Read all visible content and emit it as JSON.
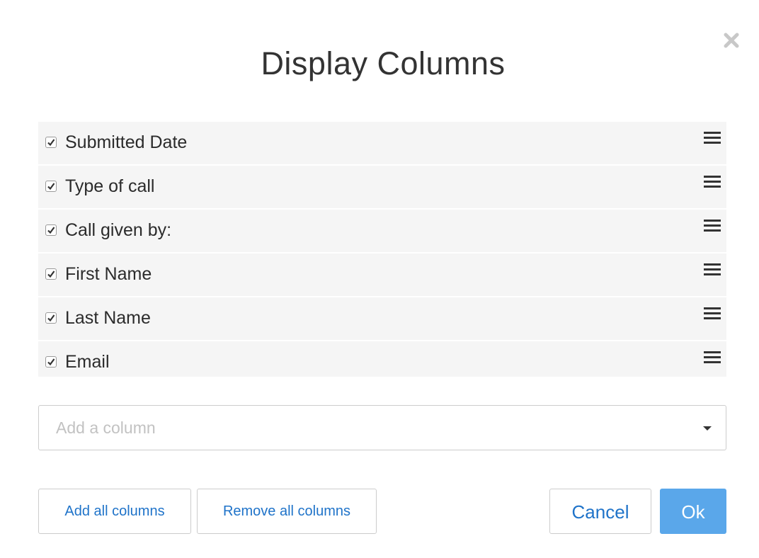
{
  "dialog": {
    "title": "Display Columns",
    "close_icon": "close-icon"
  },
  "columns": [
    {
      "label": "Submitted Date",
      "checked": true
    },
    {
      "label": "Type of call",
      "checked": true
    },
    {
      "label": "Call given by:",
      "checked": true
    },
    {
      "label": "First Name",
      "checked": true
    },
    {
      "label": "Last Name",
      "checked": true
    },
    {
      "label": "Email",
      "checked": true
    }
  ],
  "add_column": {
    "placeholder": "Add a column"
  },
  "buttons": {
    "add_all": "Add all columns",
    "remove_all": "Remove all columns",
    "cancel": "Cancel",
    "ok": "Ok"
  },
  "colors": {
    "ok_background": "#5aa7ea",
    "link_blue": "#1f73c9",
    "row_background": "#f5f5f5"
  }
}
